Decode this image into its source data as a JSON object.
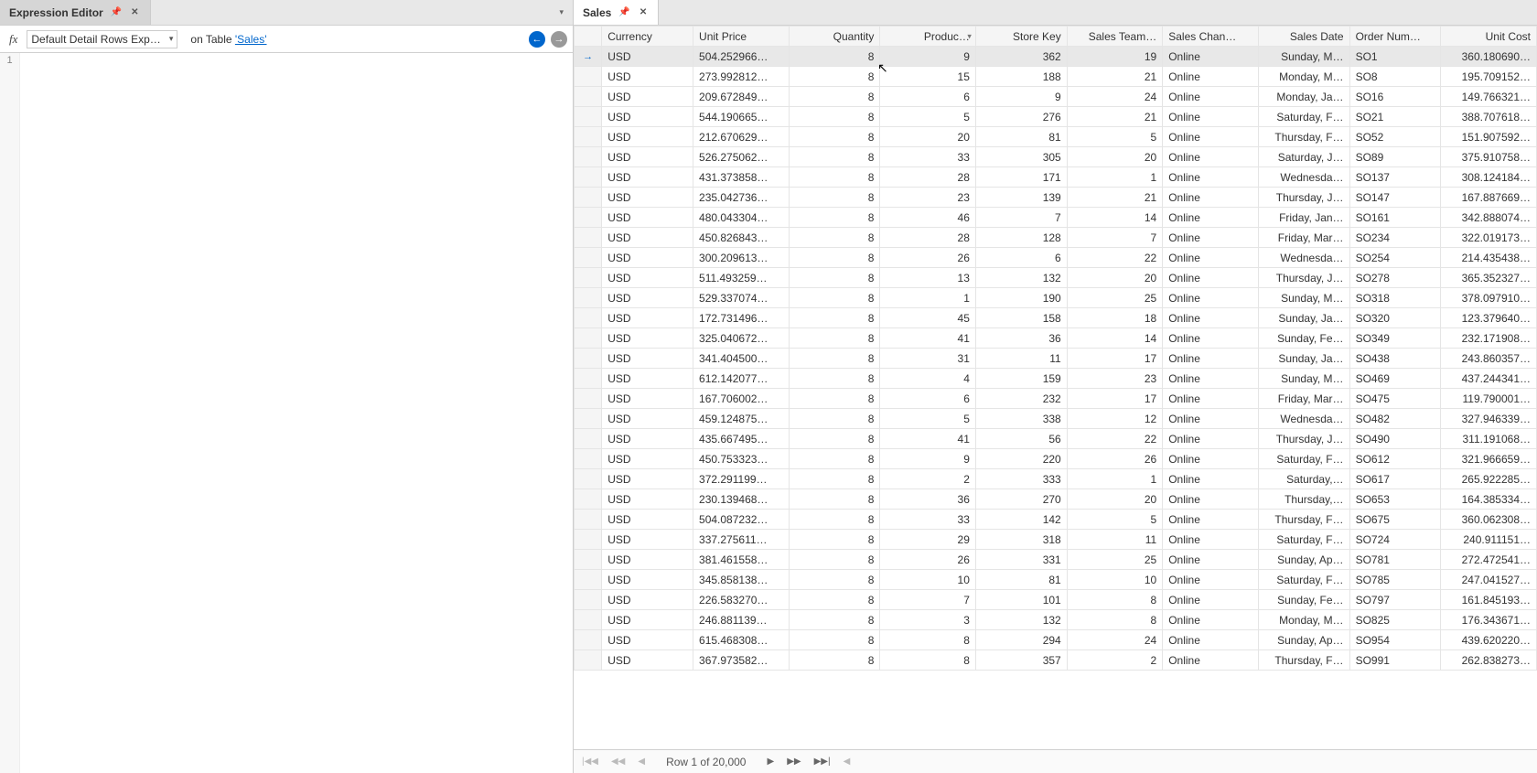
{
  "left": {
    "tab_title": "Expression Editor",
    "fx": "fx",
    "selector": "Default Detail Rows Exp…",
    "on_label": "on Table ",
    "table_link": "'Sales'",
    "gutter_line": "1"
  },
  "right": {
    "tab_title": "Sales",
    "columns": [
      {
        "key": "currency",
        "label": "Currency",
        "align": "left",
        "filter": false
      },
      {
        "key": "unit_price",
        "label": "Unit Price",
        "align": "left",
        "filter": false
      },
      {
        "key": "quantity",
        "label": "Quantity",
        "align": "right",
        "filter": false
      },
      {
        "key": "product",
        "label": "Produc…",
        "align": "right",
        "filter": true
      },
      {
        "key": "store_key",
        "label": "Store Key",
        "align": "right",
        "filter": false
      },
      {
        "key": "sales_team",
        "label": "Sales Team…",
        "align": "right",
        "filter": false
      },
      {
        "key": "sales_chan",
        "label": "Sales Chan…",
        "align": "left",
        "filter": false
      },
      {
        "key": "sales_date",
        "label": "Sales Date",
        "align": "right",
        "filter": false
      },
      {
        "key": "order_num",
        "label": "Order Num…",
        "align": "left",
        "filter": false
      },
      {
        "key": "unit_cost",
        "label": "Unit Cost",
        "align": "right",
        "filter": false
      }
    ],
    "rows": [
      {
        "currency": "USD",
        "unit_price": "504.252966…",
        "quantity": 8,
        "product": 9,
        "store_key": 362,
        "sales_team": 19,
        "sales_chan": "Online",
        "sales_date": "Sunday, M…",
        "order_num": "SO1",
        "unit_cost": "360.180690…",
        "selected": true
      },
      {
        "currency": "USD",
        "unit_price": "273.992812…",
        "quantity": 8,
        "product": 15,
        "store_key": 188,
        "sales_team": 21,
        "sales_chan": "Online",
        "sales_date": "Monday, M…",
        "order_num": "SO8",
        "unit_cost": "195.709152…"
      },
      {
        "currency": "USD",
        "unit_price": "209.672849…",
        "quantity": 8,
        "product": 6,
        "store_key": 9,
        "sales_team": 24,
        "sales_chan": "Online",
        "sales_date": "Monday, Ja…",
        "order_num": "SO16",
        "unit_cost": "149.766321…"
      },
      {
        "currency": "USD",
        "unit_price": "544.190665…",
        "quantity": 8,
        "product": 5,
        "store_key": 276,
        "sales_team": 21,
        "sales_chan": "Online",
        "sales_date": "Saturday, F…",
        "order_num": "SO21",
        "unit_cost": "388.707618…"
      },
      {
        "currency": "USD",
        "unit_price": "212.670629…",
        "quantity": 8,
        "product": 20,
        "store_key": 81,
        "sales_team": 5,
        "sales_chan": "Online",
        "sales_date": "Thursday, F…",
        "order_num": "SO52",
        "unit_cost": "151.907592…"
      },
      {
        "currency": "USD",
        "unit_price": "526.275062…",
        "quantity": 8,
        "product": 33,
        "store_key": 305,
        "sales_team": 20,
        "sales_chan": "Online",
        "sales_date": "Saturday, J…",
        "order_num": "SO89",
        "unit_cost": "375.910758…"
      },
      {
        "currency": "USD",
        "unit_price": "431.373858…",
        "quantity": 8,
        "product": 28,
        "store_key": 171,
        "sales_team": 1,
        "sales_chan": "Online",
        "sales_date": "Wednesda…",
        "order_num": "SO137",
        "unit_cost": "308.124184…"
      },
      {
        "currency": "USD",
        "unit_price": "235.042736…",
        "quantity": 8,
        "product": 23,
        "store_key": 139,
        "sales_team": 21,
        "sales_chan": "Online",
        "sales_date": "Thursday, J…",
        "order_num": "SO147",
        "unit_cost": "167.887669…"
      },
      {
        "currency": "USD",
        "unit_price": "480.043304…",
        "quantity": 8,
        "product": 46,
        "store_key": 7,
        "sales_team": 14,
        "sales_chan": "Online",
        "sales_date": "Friday, Jan…",
        "order_num": "SO161",
        "unit_cost": "342.888074…"
      },
      {
        "currency": "USD",
        "unit_price": "450.826843…",
        "quantity": 8,
        "product": 28,
        "store_key": 128,
        "sales_team": 7,
        "sales_chan": "Online",
        "sales_date": "Friday, Mar…",
        "order_num": "SO234",
        "unit_cost": "322.019173…"
      },
      {
        "currency": "USD",
        "unit_price": "300.209613…",
        "quantity": 8,
        "product": 26,
        "store_key": 6,
        "sales_team": 22,
        "sales_chan": "Online",
        "sales_date": "Wednesda…",
        "order_num": "SO254",
        "unit_cost": "214.435438…"
      },
      {
        "currency": "USD",
        "unit_price": "511.493259…",
        "quantity": 8,
        "product": 13,
        "store_key": 132,
        "sales_team": 20,
        "sales_chan": "Online",
        "sales_date": "Thursday, J…",
        "order_num": "SO278",
        "unit_cost": "365.352327…"
      },
      {
        "currency": "USD",
        "unit_price": "529.337074…",
        "quantity": 8,
        "product": 1,
        "store_key": 190,
        "sales_team": 25,
        "sales_chan": "Online",
        "sales_date": "Sunday, M…",
        "order_num": "SO318",
        "unit_cost": "378.097910…"
      },
      {
        "currency": "USD",
        "unit_price": "172.731496…",
        "quantity": 8,
        "product": 45,
        "store_key": 158,
        "sales_team": 18,
        "sales_chan": "Online",
        "sales_date": "Sunday, Ja…",
        "order_num": "SO320",
        "unit_cost": "123.379640…"
      },
      {
        "currency": "USD",
        "unit_price": "325.040672…",
        "quantity": 8,
        "product": 41,
        "store_key": 36,
        "sales_team": 14,
        "sales_chan": "Online",
        "sales_date": "Sunday, Fe…",
        "order_num": "SO349",
        "unit_cost": "232.171908…"
      },
      {
        "currency": "USD",
        "unit_price": "341.404500…",
        "quantity": 8,
        "product": 31,
        "store_key": 11,
        "sales_team": 17,
        "sales_chan": "Online",
        "sales_date": "Sunday, Ja…",
        "order_num": "SO438",
        "unit_cost": "243.860357…"
      },
      {
        "currency": "USD",
        "unit_price": "612.142077…",
        "quantity": 8,
        "product": 4,
        "store_key": 159,
        "sales_team": 23,
        "sales_chan": "Online",
        "sales_date": "Sunday, M…",
        "order_num": "SO469",
        "unit_cost": "437.244341…"
      },
      {
        "currency": "USD",
        "unit_price": "167.706002…",
        "quantity": 8,
        "product": 6,
        "store_key": 232,
        "sales_team": 17,
        "sales_chan": "Online",
        "sales_date": "Friday, Mar…",
        "order_num": "SO475",
        "unit_cost": "119.790001…"
      },
      {
        "currency": "USD",
        "unit_price": "459.124875…",
        "quantity": 8,
        "product": 5,
        "store_key": 338,
        "sales_team": 12,
        "sales_chan": "Online",
        "sales_date": "Wednesda…",
        "order_num": "SO482",
        "unit_cost": "327.946339…"
      },
      {
        "currency": "USD",
        "unit_price": "435.667495…",
        "quantity": 8,
        "product": 41,
        "store_key": 56,
        "sales_team": 22,
        "sales_chan": "Online",
        "sales_date": "Thursday, J…",
        "order_num": "SO490",
        "unit_cost": "311.191068…"
      },
      {
        "currency": "USD",
        "unit_price": "450.753323…",
        "quantity": 8,
        "product": 9,
        "store_key": 220,
        "sales_team": 26,
        "sales_chan": "Online",
        "sales_date": "Saturday, F…",
        "order_num": "SO612",
        "unit_cost": "321.966659…"
      },
      {
        "currency": "USD",
        "unit_price": "372.291199…",
        "quantity": 8,
        "product": 2,
        "store_key": 333,
        "sales_team": 1,
        "sales_chan": "Online",
        "sales_date": "Saturday,…",
        "order_num": "SO617",
        "unit_cost": "265.922285…"
      },
      {
        "currency": "USD",
        "unit_price": "230.139468…",
        "quantity": 8,
        "product": 36,
        "store_key": 270,
        "sales_team": 20,
        "sales_chan": "Online",
        "sales_date": "Thursday,…",
        "order_num": "SO653",
        "unit_cost": "164.385334…"
      },
      {
        "currency": "USD",
        "unit_price": "504.087232…",
        "quantity": 8,
        "product": 33,
        "store_key": 142,
        "sales_team": 5,
        "sales_chan": "Online",
        "sales_date": "Thursday, F…",
        "order_num": "SO675",
        "unit_cost": "360.062308…"
      },
      {
        "currency": "USD",
        "unit_price": "337.275611…",
        "quantity": 8,
        "product": 29,
        "store_key": 318,
        "sales_team": 11,
        "sales_chan": "Online",
        "sales_date": "Saturday, F…",
        "order_num": "SO724",
        "unit_cost": "240.911151…"
      },
      {
        "currency": "USD",
        "unit_price": "381.461558…",
        "quantity": 8,
        "product": 26,
        "store_key": 331,
        "sales_team": 25,
        "sales_chan": "Online",
        "sales_date": "Sunday, Ap…",
        "order_num": "SO781",
        "unit_cost": "272.472541…"
      },
      {
        "currency": "USD",
        "unit_price": "345.858138…",
        "quantity": 8,
        "product": 10,
        "store_key": 81,
        "sales_team": 10,
        "sales_chan": "Online",
        "sales_date": "Saturday, F…",
        "order_num": "SO785",
        "unit_cost": "247.041527…"
      },
      {
        "currency": "USD",
        "unit_price": "226.583270…",
        "quantity": 8,
        "product": 7,
        "store_key": 101,
        "sales_team": 8,
        "sales_chan": "Online",
        "sales_date": "Sunday, Fe…",
        "order_num": "SO797",
        "unit_cost": "161.845193…"
      },
      {
        "currency": "USD",
        "unit_price": "246.881139…",
        "quantity": 8,
        "product": 3,
        "store_key": 132,
        "sales_team": 8,
        "sales_chan": "Online",
        "sales_date": "Monday, M…",
        "order_num": "SO825",
        "unit_cost": "176.343671…"
      },
      {
        "currency": "USD",
        "unit_price": "615.468308…",
        "quantity": 8,
        "product": 8,
        "store_key": 294,
        "sales_team": 24,
        "sales_chan": "Online",
        "sales_date": "Sunday, Ap…",
        "order_num": "SO954",
        "unit_cost": "439.620220…"
      },
      {
        "currency": "USD",
        "unit_price": "367.973582…",
        "quantity": 8,
        "product": 8,
        "store_key": 357,
        "sales_team": 2,
        "sales_chan": "Online",
        "sales_date": "Thursday, F…",
        "order_num": "SO991",
        "unit_cost": "262.838273…"
      }
    ],
    "status": "Row 1 of 20,000"
  }
}
